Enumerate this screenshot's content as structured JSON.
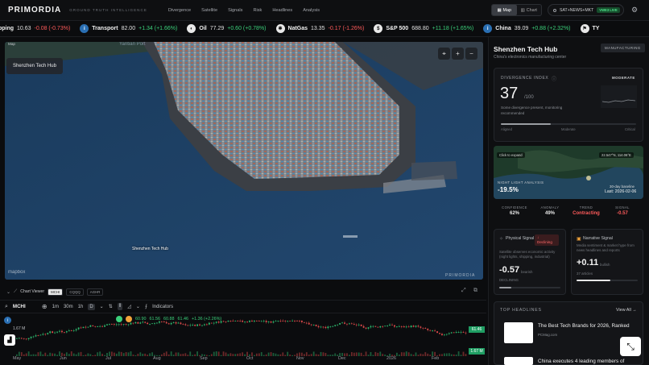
{
  "app": {
    "brand": "PRIMORDIA",
    "tagline": "GROUND TRUTH INTELLIGENCE"
  },
  "nav": [
    "Divergence",
    "Satellite",
    "Signals",
    "Risk",
    "Headlines",
    "Analysis"
  ],
  "view_toggle": {
    "map": "Map",
    "chart": "Chart"
  },
  "feed": {
    "label": "SAT+NEWS+MKT",
    "live": "VWE3 LIVE"
  },
  "ticker": [
    {
      "name": "ipping",
      "value": "10.63",
      "change": "-0.08 (-0.73%)",
      "dir": "neg",
      "icon": ""
    },
    {
      "name": "Transport",
      "value": "82.00",
      "change": "+1.34 (+1.66%)",
      "dir": "pos",
      "icon": "i"
    },
    {
      "name": "Oil",
      "value": "77.29",
      "change": "+0.60 (+0.78%)",
      "dir": "pos",
      "icon": "◐"
    },
    {
      "name": "NatGas",
      "value": "13.35",
      "change": "-0.17 (-1.26%)",
      "dir": "neg",
      "icon": "✱"
    },
    {
      "name": "S&P 500",
      "value": "688.80",
      "change": "+11.18 (+1.65%)",
      "dir": "pos",
      "icon": "$"
    },
    {
      "name": "China",
      "value": "39.09",
      "change": "+0.88 (+2.32%)",
      "dir": "pos",
      "icon": "i"
    },
    {
      "name": "TY",
      "value": "",
      "change": "",
      "dir": "pos",
      "icon": "⚑"
    }
  ],
  "map": {
    "badge": "Map",
    "location_chip": "Shenzhen Tech Hub",
    "top_label": "Yantian Port",
    "pin_label": "Shenzhen Tech Hub",
    "attribution": "mapbox",
    "watermark": "PRIMORDIA"
  },
  "chart_viewer": {
    "title": "Chart Viewer",
    "symbols": [
      "MCHI",
      "CQQQ",
      "AGHR"
    ],
    "active_symbol": "MCHI",
    "intervals": [
      "1m",
      "30m",
      "1h",
      "D"
    ],
    "indicators_label": "Indicators",
    "ohlc": {
      "o": "60.90",
      "h": "61.56",
      "l": "60.88",
      "c": "61.46",
      "chg": "+1.36 (+2.26%)"
    },
    "last_price": "61.46",
    "volume": "1.67 M",
    "volume_left": "1.67 M",
    "x_labels": [
      "May",
      "Jun",
      "Jul",
      "Aug",
      "Sep",
      "Oct",
      "Nov",
      "Dec",
      "2026",
      "Feb"
    ]
  },
  "panel": {
    "title": "Shenzhen Tech Hub",
    "subtitle": "China's electronics manufacturing center",
    "tag": "MANUFACTURING",
    "divergence": {
      "label": "DIVERGENCE INDEX",
      "level": "MODERATE",
      "value": "37",
      "denominator": "/100",
      "description": "Some divergence present, monitoring recommended",
      "progress": 0.37,
      "scale": [
        "Aligned",
        "Moderate",
        "Critical"
      ]
    },
    "night_light": {
      "expand": "Click to expand",
      "coords": "22.547°N, 114.06°E",
      "title": "NIGHT LIGHT ANALYSIS",
      "value": "-19.5%",
      "meta": "30-day baseline",
      "last": "Last: 2026-02-06"
    },
    "stats": [
      {
        "label": "CONFIDENCE",
        "value": "62%",
        "red": false
      },
      {
        "label": "ANOMALY",
        "value": "49%",
        "red": false
      },
      {
        "label": "TREND",
        "value": "Contracting",
        "red": true
      },
      {
        "label": "SIGNAL",
        "value": "-0.57",
        "red": true
      }
    ],
    "physical": {
      "title": "Physical Signal",
      "status_line1": "↓",
      "status_line2": "Declining",
      "desc": "Satellite observes economic activity (night lights, shipping, industrial)",
      "value": "-0.57",
      "unit": "bearish",
      "foot": "DECLINING",
      "progress": 0.2
    },
    "narrative": {
      "title": "Narrative Signal",
      "desc": "Media sentiment & market hype from news headlines and reports",
      "value": "+0.11",
      "unit": "bullish",
      "foot": "37 articles",
      "progress": 0.55
    },
    "headlines": {
      "title": "TOP HEADLINES",
      "view_all": "View All →",
      "items": [
        {
          "text": "The Best Tech Brands for 2026, Ranked",
          "source": "PCMag.com"
        },
        {
          "text": "China executes 4 leading members of",
          "source": ""
        }
      ]
    }
  },
  "colors": {
    "up": "#3bd07a",
    "down": "#ff5b5b",
    "sea": "#1d3f62",
    "land": "#2a3f38"
  }
}
